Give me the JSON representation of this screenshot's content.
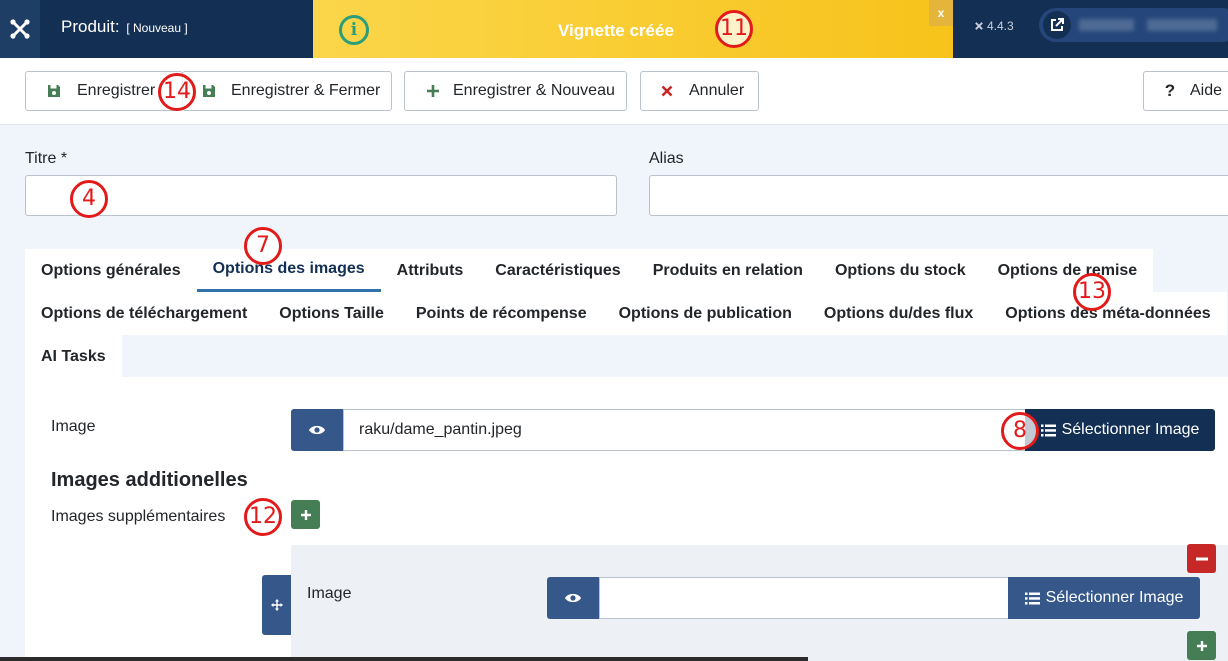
{
  "header": {
    "title": "Produit:",
    "title_sub": "[ Nouveau ]",
    "version": "4.4.3"
  },
  "toast": {
    "message": "Vignette créée",
    "close": "x"
  },
  "toolbar": {
    "save": "Enregistrer",
    "save_close": "Enregistrer & Fermer",
    "save_new": "Enregistrer & Nouveau",
    "cancel": "Annuler",
    "help": "Aide"
  },
  "form": {
    "title_label": "Titre *",
    "title_value": "",
    "alias_label": "Alias",
    "alias_value": ""
  },
  "tabs": {
    "row1": [
      "Options générales",
      "Options des images",
      "Attributs",
      "Caractéristiques",
      "Produits en relation",
      "Options du stock",
      "Options de remise"
    ],
    "row2": [
      "Options de téléchargement",
      "Options Taille",
      "Points de récompense",
      "Options de publication",
      "Options du/des flux",
      "Options des méta-données"
    ],
    "row3": [
      "AI Tasks"
    ],
    "active": "Options des images"
  },
  "images_panel": {
    "image_label": "Image",
    "image_value": "raku/dame_pantin.jpeg",
    "select_image": "Sélectionner Image",
    "additional_heading": "Images additionelles",
    "supplementary_label": "Images supplémentaires",
    "sub_image_label": "Image",
    "sub_image_value": "",
    "sub_select_image": "Sélectionner Image"
  },
  "markers": [
    "11",
    "14",
    "4",
    "7",
    "13",
    "8",
    "12"
  ],
  "colors": {
    "header_bg": "#132f53",
    "toast_bg": "#f7c31b",
    "primary_btn": "#35578a",
    "success_btn": "#457d54",
    "danger_btn": "#c52827",
    "marker": "#e21a1a"
  }
}
